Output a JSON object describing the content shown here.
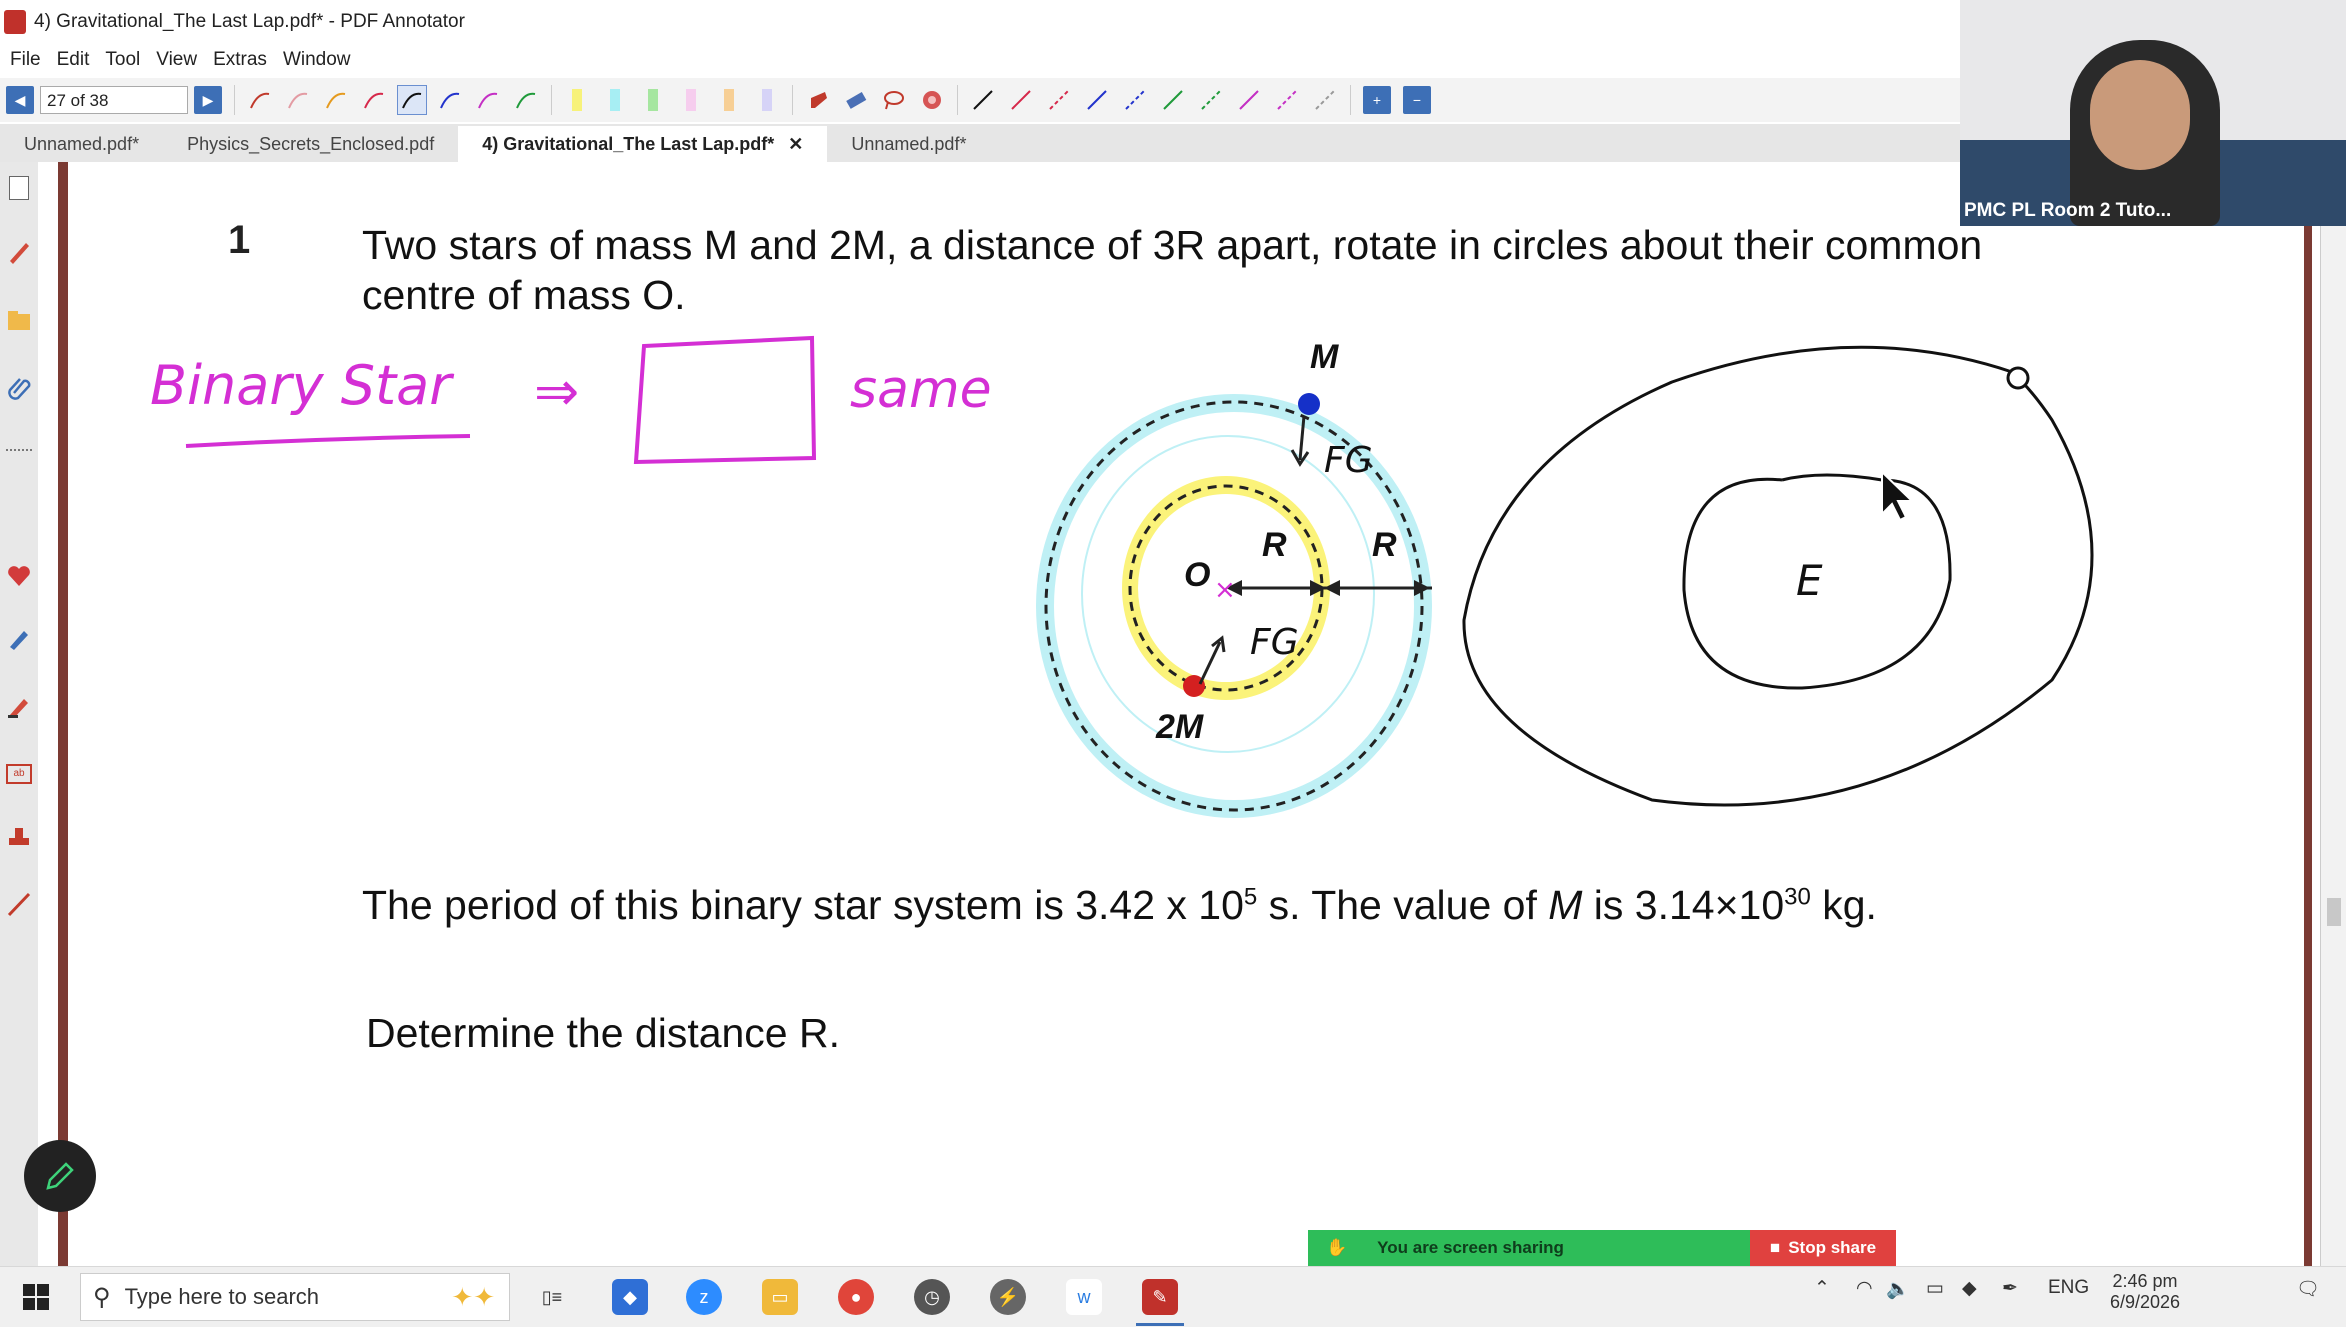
{
  "window": {
    "title": "4) Gravitational_The Last Lap.pdf* - PDF Annotator"
  },
  "menu": [
    "File",
    "Edit",
    "Tool",
    "View",
    "Extras",
    "Window"
  ],
  "toolbar": {
    "page_indicator": "27 of 38"
  },
  "tabs": [
    {
      "label": "Unnamed.pdf*"
    },
    {
      "label": "Physics_Secrets_Enclosed.pdf"
    },
    {
      "label": "4) Gravitational_The Last Lap.pdf*",
      "active": true,
      "close": "✕"
    },
    {
      "label": "Unnamed.pdf*"
    }
  ],
  "document": {
    "question_number": "1",
    "question_line1": "Two stars of mass M and 2M, a distance of 3R apart, rotate in circles about their common",
    "question_line2": "centre of mass O.",
    "diagram_labels": {
      "M": "M",
      "2M": "2M",
      "O": "O",
      "R1": "R",
      "R2": "R"
    },
    "period_text_a": "The period of this binary star system is 3.42 x 10",
    "period_exp": "5",
    "period_text_b": " s. The value of ",
    "period_M": "M",
    "period_text_c": " is  3.14×10",
    "period_exp2": "30",
    "period_text_d": "  kg.",
    "task": "Determine the distance R."
  },
  "ink_annotations": {
    "binary_star": "Binary Star",
    "implies": "⇒",
    "same": "same",
    "fg1": "FG",
    "fg2": "FG",
    "earth_label": "E"
  },
  "webcam": {
    "label": "PMC PL Room 2 Tuto..."
  },
  "screen_share": {
    "message": "You are screen sharing",
    "stop": "Stop share"
  },
  "taskbar": {
    "search_placeholder": "Type here to search",
    "language": "ENG",
    "time": "2:46 pm",
    "date": "6/9/2026"
  },
  "colors": {
    "accent": "#3d6fb6",
    "ink": "#d42fd4",
    "share_green": "#2ebd59",
    "stop_red": "#e0413f"
  }
}
